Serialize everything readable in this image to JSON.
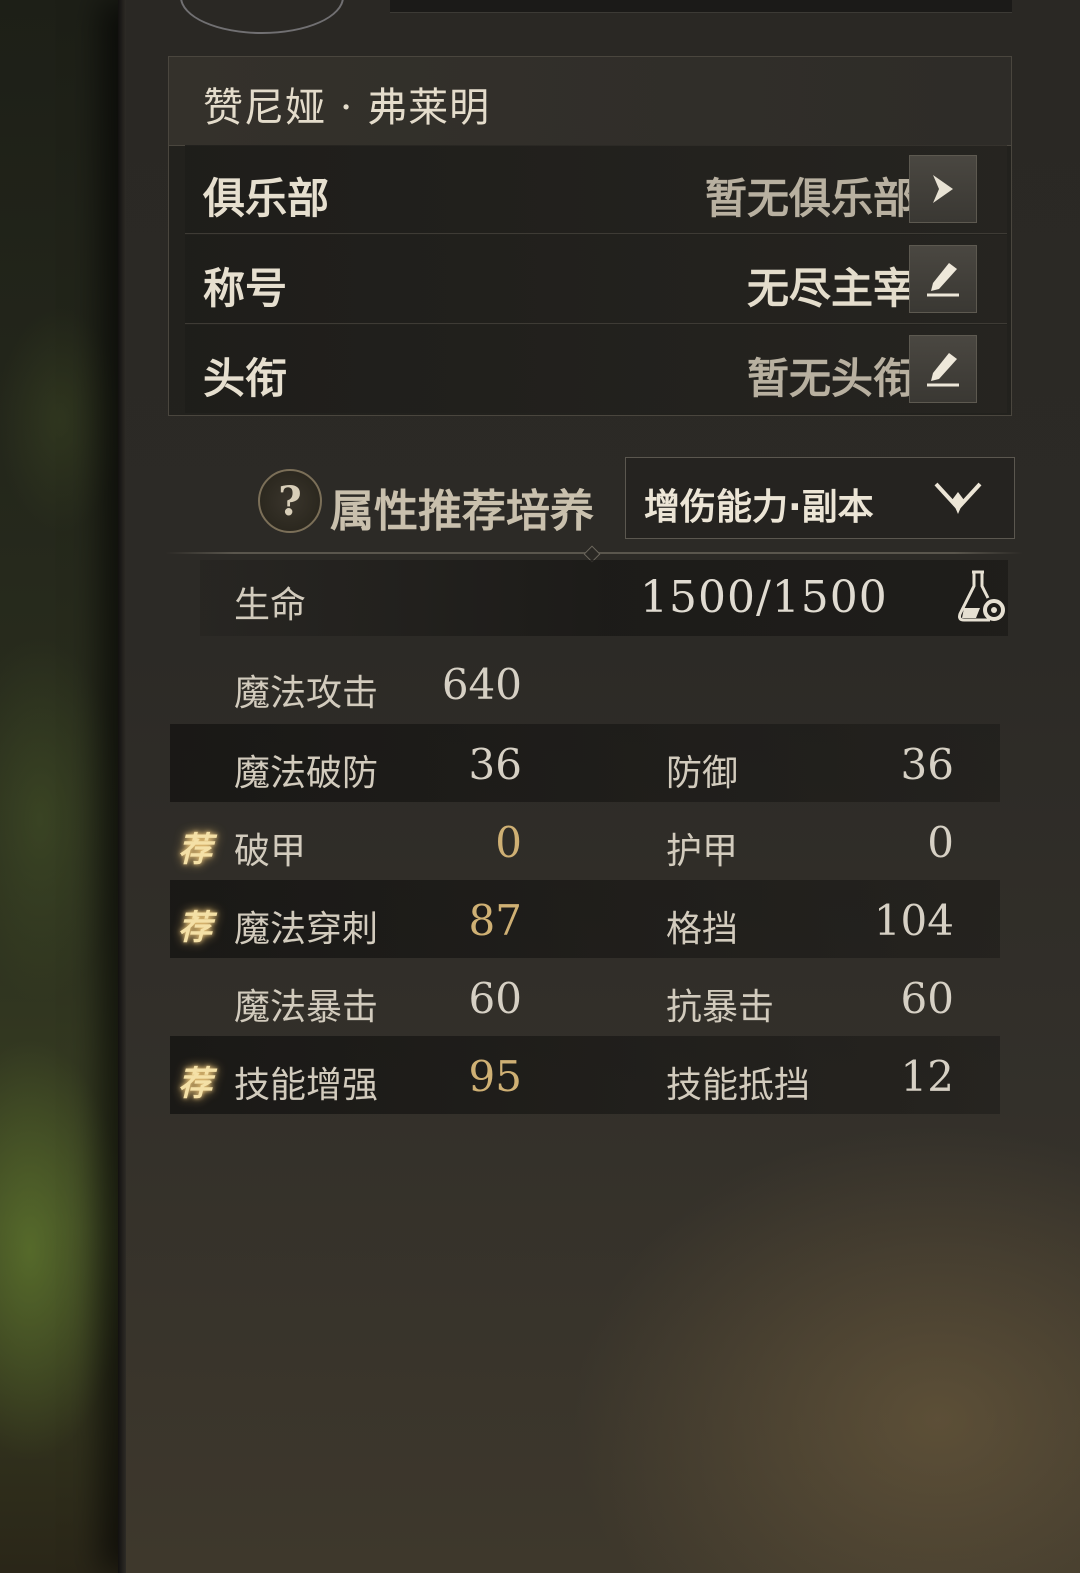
{
  "character": {
    "name": "赞尼娅 · 弗莱明"
  },
  "info_rows": [
    {
      "label": "俱乐部",
      "value": "暂无俱乐部",
      "icon": "arrow-right-icon"
    },
    {
      "label": "称号",
      "value": "无尽主宰",
      "icon": "edit-icon"
    },
    {
      "label": "头衔",
      "value": "暂无头衔",
      "icon": "edit-icon"
    }
  ],
  "recommend": {
    "label": "属性推荐培养",
    "selected": "增伤能力·副本"
  },
  "hp": {
    "label": "生命",
    "value": "1500/1500"
  },
  "stats": {
    "magic_attack": {
      "label": "魔法攻击",
      "value": "640"
    },
    "rows": [
      {
        "left": {
          "label": "魔法破防",
          "value": "36",
          "recommended": false
        },
        "right": {
          "label": "防御",
          "value": "36"
        }
      },
      {
        "left": {
          "label": "破甲",
          "value": "0",
          "recommended": true
        },
        "right": {
          "label": "护甲",
          "value": "0"
        }
      },
      {
        "left": {
          "label": "魔法穿刺",
          "value": "87",
          "recommended": true
        },
        "right": {
          "label": "格挡",
          "value": "104"
        }
      },
      {
        "left": {
          "label": "魔法暴击",
          "value": "60",
          "recommended": false
        },
        "right": {
          "label": "抗暴击",
          "value": "60"
        }
      },
      {
        "left": {
          "label": "技能增强",
          "value": "95",
          "recommended": true
        },
        "right": {
          "label": "技能抵挡",
          "value": "12"
        }
      }
    ],
    "recommend_badge": "荐"
  },
  "colors": {
    "accent_gold": "#cfb074",
    "text": "#d2cbbd",
    "badge_glow": "#f4e0a6"
  }
}
